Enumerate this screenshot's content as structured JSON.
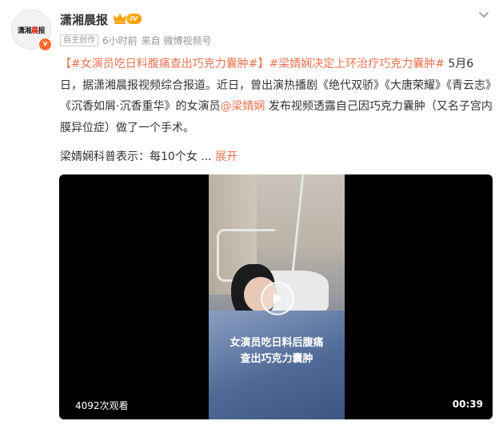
{
  "account": {
    "name": "潇湘晨报",
    "avatar_text_black": "潇湘",
    "avatar_text_red": "晨",
    "avatar_text_black_2": "报",
    "level": "IV",
    "verified_mark": "v"
  },
  "meta": {
    "tag": "自主创作",
    "time": "6小时前",
    "source": "来自 微博视频号"
  },
  "post": {
    "bracket_open": "【",
    "topic1": "#女演员吃日料腹痛查出巧克力囊肿#",
    "bracket_close": "】",
    "topic2": "#梁婧娴决定上环治疗巧克力囊肿#",
    "text1": " 5月6日，据潇湘晨报视频综合报道。近日，曾出演热播剧《绝代双骄》《大唐荣耀》《青云志》《沉香如屑·沉香重华》的女演员",
    "mention": "@梁婧娴",
    "text2": " 发布视频透露自己因巧克力囊肿（又名子宫内膜异位症）做了一个手术。"
  },
  "preview": {
    "text": "梁婧娴科普表示：每10个女 ...",
    "expand": "展开"
  },
  "video": {
    "caption_line1": "女演员吃日料后腹痛",
    "caption_line2": "查出巧克力囊肿",
    "views": "4092次观看",
    "duration": "00:39"
  },
  "icons": {
    "crown": "crown-icon",
    "more": "chevron-down-icon",
    "play": "play-icon"
  },
  "colors": {
    "link": "#eb7350",
    "level_badge": "#ffa10f",
    "verified": "#ff6b2c"
  }
}
